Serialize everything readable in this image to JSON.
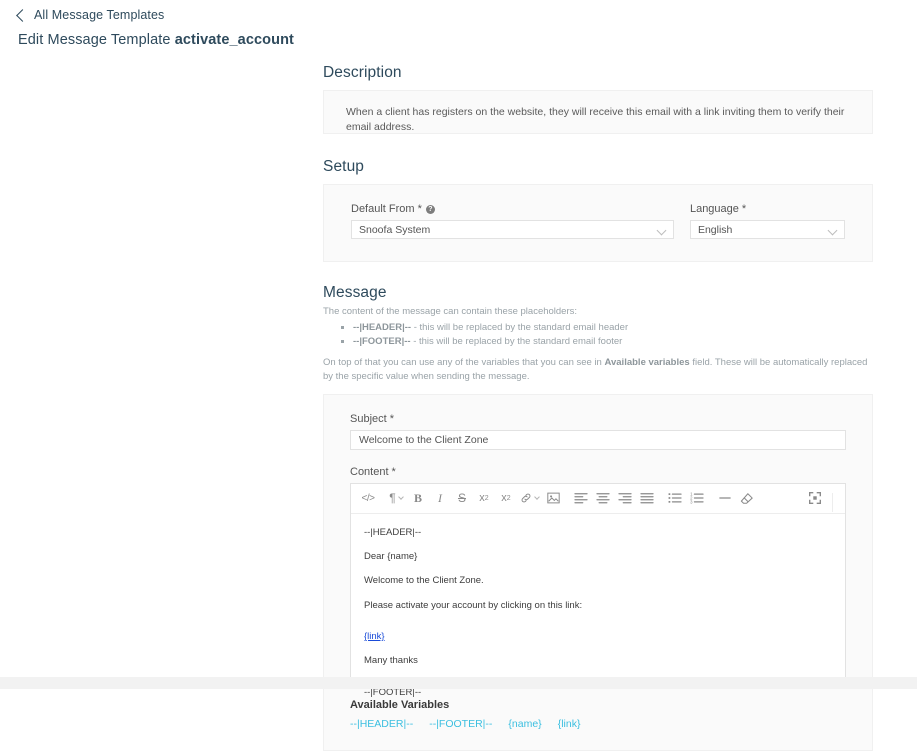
{
  "breadcrumb": {
    "back_icon": "chevron-left-icon",
    "label": "All Message Templates"
  },
  "page_title": {
    "prefix": "Edit Message Template",
    "template_name": "activate_account"
  },
  "sections": {
    "description": {
      "heading": "Description",
      "text": "When a client has registers on the website, they will receive this email with a link inviting them to verify their email address."
    },
    "setup": {
      "heading": "Setup",
      "default_from": {
        "label": "Default From",
        "required_marker": "*",
        "help_icon": "question-mark-icon",
        "help_glyph": "?",
        "value": "Snoofa System"
      },
      "language": {
        "label": "Language",
        "required_marker": "*",
        "value": "English"
      }
    },
    "message": {
      "heading": "Message",
      "intro": "The content of the message can contain these placeholders:",
      "placeholders": [
        {
          "token": "--|HEADER|--",
          "description": " - this will be replaced by the standard email header"
        },
        {
          "token": "--|FOOTER|--",
          "description": " - this will be replaced by the standard email footer"
        }
      ],
      "note_before": "On top of that you can use any of the variables that you can see in ",
      "note_bold": "Available variables",
      "note_after": " field. These will be automatically replaced by the specific value when sending the message.",
      "subject": {
        "label": "Subject",
        "required_marker": "*",
        "value": "Welcome to the Client Zone"
      },
      "content": {
        "label": "Content",
        "required_marker": "*",
        "toolbar": [
          {
            "name": "code-icon",
            "glyph": "</>",
            "dropdown": false
          },
          {
            "name": "paragraph-format-icon",
            "glyph": "¶",
            "dropdown": true
          },
          {
            "name": "bold-icon",
            "glyph": "B",
            "dropdown": false
          },
          {
            "name": "italic-icon",
            "glyph": "I",
            "dropdown": false
          },
          {
            "name": "strikethrough-icon",
            "glyph": "S",
            "dropdown": false
          },
          {
            "name": "superscript-icon",
            "glyph": "x2",
            "dropdown": false
          },
          {
            "name": "subscript-icon",
            "glyph": "x2",
            "dropdown": false
          },
          {
            "name": "link-icon",
            "glyph": "link",
            "dropdown": true
          },
          {
            "name": "image-icon",
            "glyph": "image",
            "dropdown": false
          },
          {
            "name": "align-left-icon",
            "glyph": "align",
            "dropdown": false
          },
          {
            "name": "align-center-icon",
            "glyph": "align",
            "dropdown": false
          },
          {
            "name": "align-right-icon",
            "glyph": "align",
            "dropdown": false
          },
          {
            "name": "align-justify-icon",
            "glyph": "align",
            "dropdown": false
          },
          {
            "name": "bullet-list-icon",
            "glyph": "list",
            "dropdown": false
          },
          {
            "name": "numbered-list-icon",
            "glyph": "list",
            "dropdown": false
          },
          {
            "name": "horizontal-rule-icon",
            "glyph": "—",
            "dropdown": false
          },
          {
            "name": "clear-formatting-icon",
            "glyph": "eraser",
            "dropdown": false
          }
        ],
        "fullscreen_icon": "fullscreen-expand-icon",
        "body": [
          {
            "text": "--|HEADER|--",
            "type": "plain"
          },
          {
            "text": "Dear {name}",
            "type": "plain"
          },
          {
            "text": "Welcome to the Client Zone.",
            "type": "plain"
          },
          {
            "text": "Please activate your account by clicking on this link:",
            "type": "plain"
          },
          {
            "text": "{link}",
            "type": "link"
          },
          {
            "text": "Many thanks",
            "type": "plain"
          },
          {
            "text": "--|FOOTER|--",
            "type": "plain"
          }
        ]
      },
      "available_variables": {
        "title": "Available Variables",
        "items": [
          "--|HEADER|--",
          "--|FOOTER|--",
          "{name}",
          "{link}"
        ]
      }
    }
  },
  "colors": {
    "heading": "#2e4a5c",
    "variable_cyan": "#3bbfe0",
    "editor_link": "#1a4bd8",
    "panel_bg": "#fafafa"
  }
}
